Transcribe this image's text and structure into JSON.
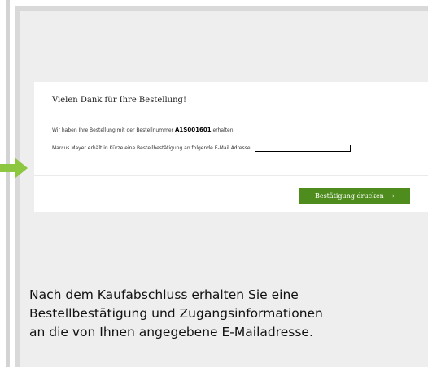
{
  "order_confirmation": {
    "title": "Vielen Dank für Ihre Bestellung!",
    "order_text_before": "Wir haben Ihre Bestellung mit der Bestellnummer",
    "order_number": "A1S001601",
    "order_text_after": "erhalten.",
    "email_notice": "Marcus Mayer erhält in Kürze eine Bestellbestätigung an folgende E-Mail Adresse:",
    "print_button_label": "Bestätigung drucken",
    "print_button_chevron": "›"
  },
  "caption": {
    "line1": "Nach dem Kaufabschluss erhalten Sie eine",
    "line2": "Bestellbestätigung und Zugangsinformationen",
    "line3": "an die von Ihnen angegebene E-Mailadresse."
  },
  "colors": {
    "accent_green": "#4f8c1e",
    "arrow_green": "#8dc63f",
    "panel_bg": "#eeeeee"
  },
  "icons": {
    "arrow": "arrow-right-icon",
    "chevron": "chevron-right-icon"
  }
}
